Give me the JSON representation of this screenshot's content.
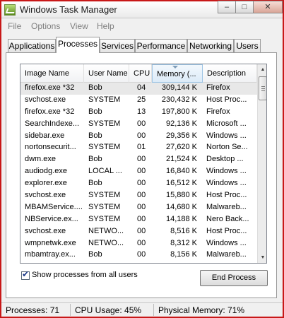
{
  "window": {
    "title": "Windows Task Manager",
    "min_glyph": "–",
    "max_glyph": "□",
    "close_glyph": "✕"
  },
  "menu": [
    "File",
    "Options",
    "View",
    "Help"
  ],
  "tabs": [
    "Applications",
    "Processes",
    "Services",
    "Performance",
    "Networking",
    "Users"
  ],
  "active_tab": "Processes",
  "table": {
    "columns": [
      "Image Name",
      "User Name",
      "CPU",
      "Memory (...",
      "Description"
    ],
    "sorted_column": "Memory (...",
    "rows": [
      [
        "firefox.exe *32",
        "Bob",
        "04",
        "309,144 K",
        "Firefox"
      ],
      [
        "svchost.exe",
        "SYSTEM",
        "25",
        "230,432 K",
        "Host Proc..."
      ],
      [
        "firefox.exe *32",
        "Bob",
        "13",
        "197,800 K",
        "Firefox"
      ],
      [
        "SearchIndexe...",
        "SYSTEM",
        "00",
        "92,136 K",
        "Microsoft ..."
      ],
      [
        "sidebar.exe",
        "Bob",
        "00",
        "29,356 K",
        "Windows ..."
      ],
      [
        "nortonsecurit...",
        "SYSTEM",
        "01",
        "27,620 K",
        "Norton Se..."
      ],
      [
        "dwm.exe",
        "Bob",
        "00",
        "21,524 K",
        "Desktop ..."
      ],
      [
        "audiodg.exe",
        "LOCAL ...",
        "00",
        "16,840 K",
        "Windows ..."
      ],
      [
        "explorer.exe",
        "Bob",
        "00",
        "16,512 K",
        "Windows ..."
      ],
      [
        "svchost.exe",
        "SYSTEM",
        "00",
        "15,880 K",
        "Host Proc..."
      ],
      [
        "MBAMService....",
        "SYSTEM",
        "00",
        "14,680 K",
        "Malwareb..."
      ],
      [
        "NBService.ex...",
        "SYSTEM",
        "00",
        "14,188 K",
        "Nero Back..."
      ],
      [
        "svchost.exe",
        "NETWO...",
        "00",
        "8,516 K",
        "Host Proc..."
      ],
      [
        "wmpnetwk.exe",
        "NETWO...",
        "00",
        "8,312 K",
        "Windows ..."
      ],
      [
        "mbamtray.ex...",
        "Bob",
        "00",
        "8,156 K",
        "Malwareb..."
      ]
    ],
    "selected_row": 0
  },
  "show_all_users": {
    "label": "Show processes from all users",
    "checked": true,
    "check_glyph": "✔"
  },
  "end_process_label": "End Process",
  "scrollbar": {
    "up_glyph": "▲",
    "down_glyph": "▼"
  },
  "status": {
    "processes": "Processes: 71",
    "cpu": "CPU Usage: 45%",
    "memory": "Physical Memory: 71%"
  }
}
